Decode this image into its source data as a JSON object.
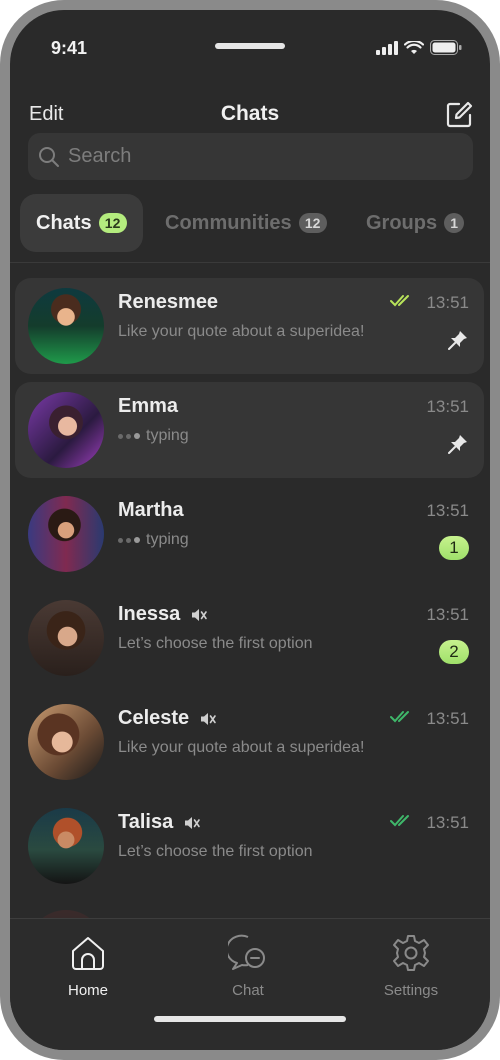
{
  "status_bar": {
    "time": "9:41"
  },
  "header": {
    "edit_label": "Edit",
    "title": "Chats"
  },
  "search": {
    "placeholder": "Search"
  },
  "tabs": [
    {
      "label": "Chats",
      "count": "12",
      "active": true
    },
    {
      "label": "Communities",
      "count": "12",
      "active": false
    },
    {
      "label": "Groups",
      "count": "1",
      "active": false
    }
  ],
  "chats": [
    {
      "name": "Renesmee",
      "message": "Like your quote about a superidea!",
      "time": "13:51",
      "pinned": true,
      "read_checks": true,
      "check_color": "#b8e35a"
    },
    {
      "name": "Emma",
      "message": "typing",
      "time": "13:51",
      "pinned": true,
      "typing": true
    },
    {
      "name": "Martha",
      "message": "typing",
      "time": "13:51",
      "typing": true,
      "unread": "1"
    },
    {
      "name": "Inessa",
      "message": "Let’s choose the first option",
      "time": "13:51",
      "muted": true,
      "unread": "2"
    },
    {
      "name": "Celeste",
      "message": "Like your quote about a superidea!",
      "time": "13:51",
      "muted": true,
      "read_checks": true,
      "check_color": "#3fb76a"
    },
    {
      "name": "Talisa",
      "message": "Let’s choose the first option",
      "time": "13:51",
      "muted": true,
      "read_checks": true,
      "check_color": "#3fb76a"
    }
  ],
  "tabbar": [
    {
      "label": "Home",
      "icon": "home-icon",
      "active": true
    },
    {
      "label": "Chat",
      "icon": "chat-bubble-icon",
      "active": false
    },
    {
      "label": "Settings",
      "icon": "gear-icon",
      "active": false
    }
  ],
  "colors": {
    "background": "#2a2a2a",
    "accent_green": "#b4ec7e",
    "check_green": "#3fb76a"
  }
}
